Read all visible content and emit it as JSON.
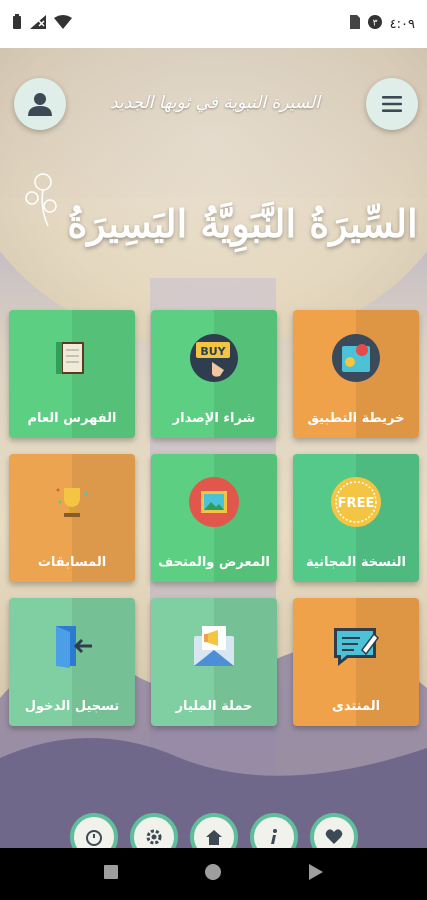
{
  "status_bar": {
    "time": "٤:٠٩",
    "icons": [
      "battery-icon",
      "signal-icon",
      "wifi-icon",
      "sim-icon",
      "notification-icon"
    ]
  },
  "header": {
    "subtitle": "السيرة النبوية في ثوبها الجديد",
    "title": "السِّيرَةُ النَّبَوِيَّةُ اليَسِيرَةُ",
    "profile_icon": "user-icon",
    "menu_icon": "hamburger-menu-icon"
  },
  "tiles": [
    {
      "label": "خريطة التطبيق",
      "icon": "map-pin-icon",
      "color": "#f0a24a"
    },
    {
      "label": "شراء الإصدار",
      "icon": "buy-sign-icon",
      "color": "#5ccf82"
    },
    {
      "label": "الفهرس العام",
      "icon": "book-icon",
      "color": "#5ccf82"
    },
    {
      "label": "النسخة المجانية",
      "icon": "free-badge-icon",
      "color": "#54c98a"
    },
    {
      "label": "المعرض والمتحف",
      "icon": "picture-frame-icon",
      "color": "#5ccf82"
    },
    {
      "label": "المسابقات",
      "icon": "trophy-icon",
      "color": "#eda451"
    },
    {
      "label": "المنتدى",
      "icon": "forum-chat-icon",
      "color": "#f0a24a"
    },
    {
      "label": "حملة المليار",
      "icon": "megaphone-mail-icon",
      "color": "#7fcfa2"
    },
    {
      "label": "تسجيل الدخول",
      "icon": "login-door-icon",
      "color": "#7fcfa2"
    }
  ],
  "bottom_nav": [
    "alarm-icon",
    "gear-icon",
    "home-icon",
    "info-icon",
    "heart-icon"
  ],
  "colors": {
    "accent_green": "#5fbf9c",
    "tile_orange": "#f0a24a",
    "tile_green": "#5ccf82"
  }
}
